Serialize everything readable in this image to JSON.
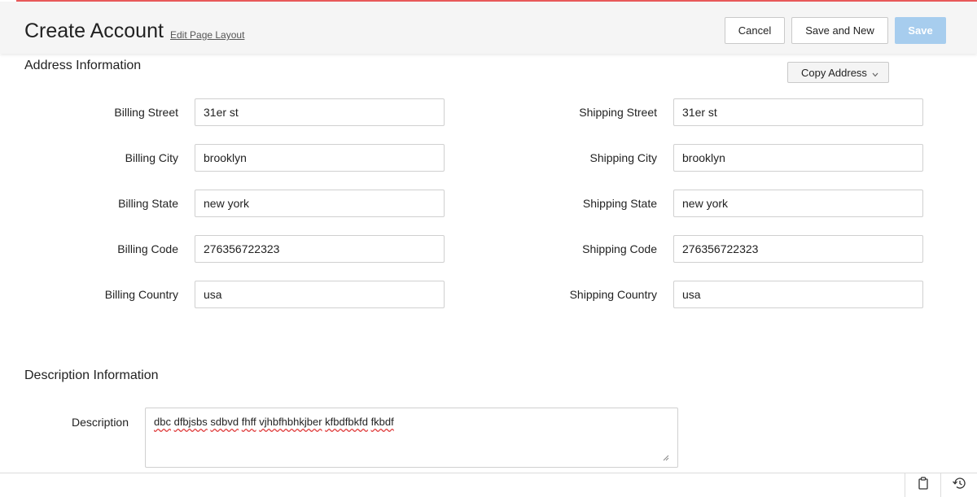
{
  "header": {
    "title": "Create Account",
    "edit_layout_link": "Edit Page Layout",
    "cancel_label": "Cancel",
    "save_and_new_label": "Save and New",
    "save_label": "Save"
  },
  "address": {
    "section_title": "Address Information",
    "copy_address_label": "Copy Address",
    "billing": [
      {
        "label": "Billing Street",
        "value": "31er st"
      },
      {
        "label": "Billing City",
        "value": "brooklyn"
      },
      {
        "label": "Billing State",
        "value": "new york"
      },
      {
        "label": "Billing Code",
        "value": "276356722323"
      },
      {
        "label": "Billing Country",
        "value": "usa"
      }
    ],
    "shipping": [
      {
        "label": "Shipping Street",
        "value": "31er st"
      },
      {
        "label": "Shipping City",
        "value": "brooklyn"
      },
      {
        "label": "Shipping State",
        "value": "new york"
      },
      {
        "label": "Shipping Code",
        "value": "276356722323"
      },
      {
        "label": "Shipping Country",
        "value": "usa"
      }
    ]
  },
  "description": {
    "section_title": "Description Information",
    "label": "Description",
    "value_words": [
      "dbc",
      "dfbjsbs",
      "sdbvd",
      "fhff",
      "vjhbfhbhkjber",
      "kfbdfbkfd",
      "fkbdf"
    ]
  },
  "icons": {
    "footer_left": "clipboard-icon",
    "footer_right": "history-icon",
    "copy_address_caret": "chevron-down-icon"
  },
  "colors": {
    "accent_line": "#e8595a",
    "save_button_disabled": "#a7cdee",
    "header_background": "#f5f5f5"
  }
}
